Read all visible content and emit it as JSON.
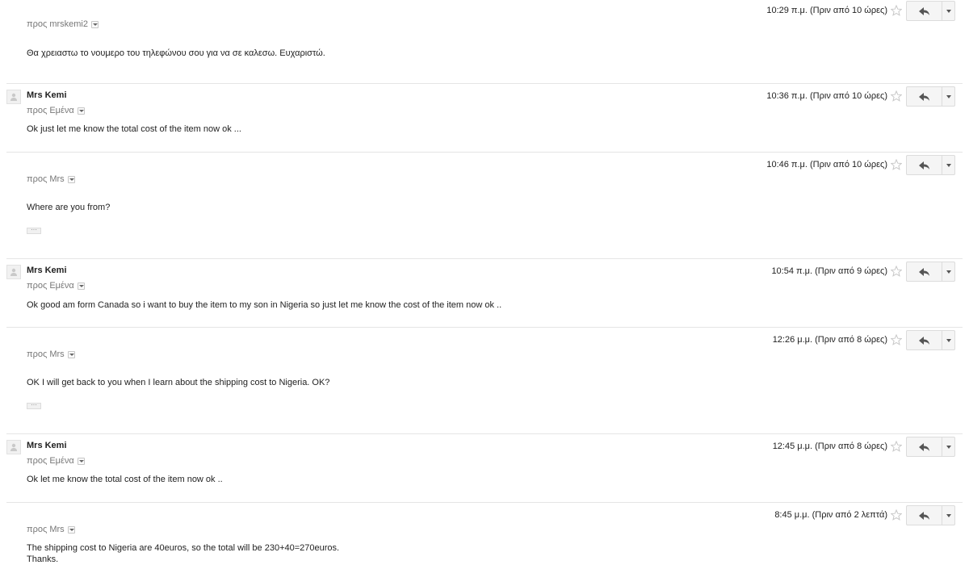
{
  "messages": [
    {
      "sender": "",
      "to": "προς mrskemi2",
      "time": "10:29 π.μ. (Πριν από 10 ώρες)",
      "body": "Θα χρειαστω το νουμερο του τηλεφώνου σου για να σε καλεσω. Ευχαριστώ.",
      "collapsed_quote": false
    },
    {
      "sender": "Mrs Kemi",
      "to": "προς Εμένα",
      "time": "10:36 π.μ. (Πριν από 10 ώρες)",
      "body": "Ok just let me know the total cost of the item now ok ...",
      "collapsed_quote": false
    },
    {
      "sender": "",
      "to": "προς Mrs",
      "time": "10:46 π.μ. (Πριν από 10 ώρες)",
      "body": "Where are you from?",
      "collapsed_quote": true
    },
    {
      "sender": "Mrs Kemi",
      "to": "προς Εμένα",
      "time": "10:54 π.μ. (Πριν από 9 ώρες)",
      "body": "Ok good am form Canada so i want to buy the item to my son in Nigeria so just let me know the cost of the item now ok ..",
      "collapsed_quote": false
    },
    {
      "sender": "",
      "to": "προς Mrs",
      "time": "12:26 μ.μ. (Πριν από 8 ώρες)",
      "body": "OK I will get back to you when I learn about the shipping cost to Nigeria. OK?",
      "collapsed_quote": true
    },
    {
      "sender": "Mrs Kemi",
      "to": "προς Εμένα",
      "time": "12:45 μ.μ. (Πριν από 8 ώρες)",
      "body": "Ok let me know the total cost of the item now ok ..",
      "collapsed_quote": false
    },
    {
      "sender": "",
      "to": "προς Mrs",
      "time": "8:45 μ.μ. (Πριν από 2 λεπτά)",
      "body": "The shipping cost to Nigeria are 40euros, so the total will be 230+40=270euros.\nThanks.",
      "collapsed_quote": false
    }
  ],
  "ellipsis_label": "···"
}
